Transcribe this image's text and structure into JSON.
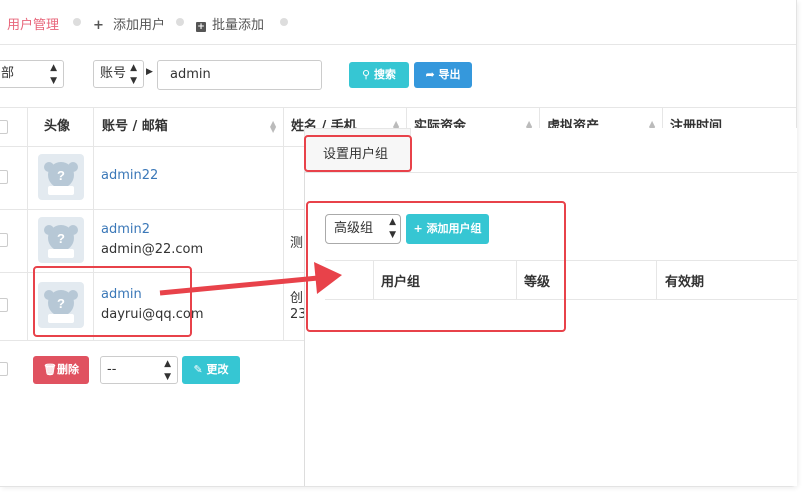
{
  "tabs": [
    {
      "label": "用户管理"
    },
    {
      "label": "添加用户"
    },
    {
      "label": "批量添加"
    }
  ],
  "filter": {
    "group_value": "部",
    "field_value": "账号",
    "search_value": "admin",
    "search_btn": "搜索",
    "export_btn": "导出"
  },
  "table": {
    "headers": [
      "头像",
      "账号 / 邮箱",
      "姓名 / 手机",
      "实际资金",
      "虚拟资产",
      "注册时间"
    ],
    "rows": [
      {
        "account": "admin22",
        "email": "",
        "name": ""
      },
      {
        "account": "admin2",
        "email": "admin@22.com",
        "name": "测"
      },
      {
        "account": "admin",
        "email": "dayrui@qq.com",
        "name": "创",
        "phone": "23"
      }
    ]
  },
  "bulk": {
    "delete_btn": "删除",
    "select_value": "--",
    "update_btn": "更改"
  },
  "panel": {
    "tab_label": "设置用户组",
    "group_select": "高级组",
    "add_group_btn": "添加用户组",
    "headers": [
      "用户组",
      "等级",
      "有效期"
    ]
  },
  "colors": {
    "accent_pink": "#e8657a",
    "teal": "#36c6d3",
    "blue": "#3598dc",
    "red": "#e05260",
    "annotation_red": "#e8424a"
  }
}
